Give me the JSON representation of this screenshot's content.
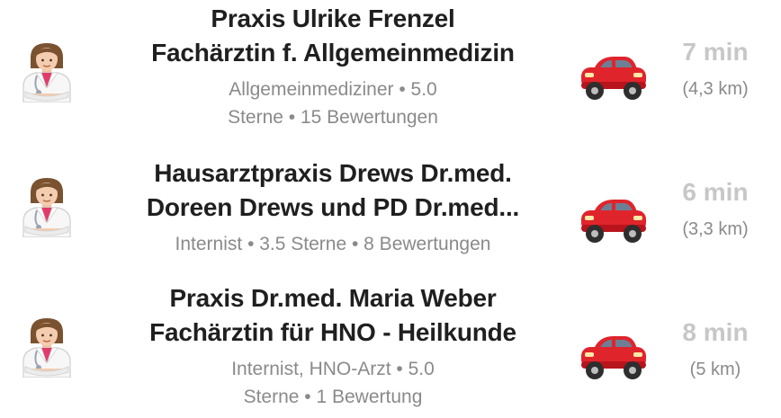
{
  "results": [
    {
      "name_line1": "Praxis Ulrike Frenzel",
      "name_line2": "Fachärztin f. Allgemeinmedizin",
      "sub_line1": "Allgemeinmediziner • 5.0",
      "sub_line2": "Sterne • 15 Bewertungen",
      "time": "7 min",
      "distance": "(4,3 km)",
      "avatar_icon": "doctor-woman-icon",
      "transport_icon": "car-icon"
    },
    {
      "name_line1": "Hausarztpraxis Drews Dr.med.",
      "name_line2": "Doreen Drews und PD Dr.med...",
      "sub_line1": "Internist • 3.5 Sterne • 8 Bewertungen",
      "sub_line2": "",
      "time": "6 min",
      "distance": "(3,3 km)",
      "avatar_icon": "doctor-woman-icon",
      "transport_icon": "car-icon"
    },
    {
      "name_line1": "Praxis Dr.med. Maria Weber",
      "name_line2": "Fachärztin für HNO - Heilkunde",
      "sub_line1": "Internist, HNO-Arzt • 5.0",
      "sub_line2": "Sterne • 1 Bewertung",
      "time": "8 min",
      "distance": "(5 km)",
      "avatar_icon": "doctor-woman-icon",
      "transport_icon": "car-icon"
    }
  ],
  "colors": {
    "name": "#1f1f1f",
    "subtext": "#8a8a8a",
    "time": "#c7c7c7",
    "car": "#e0242c",
    "coat": "#f7f7f7",
    "skin": "#f4cdb0",
    "hair": "#7a5230"
  }
}
